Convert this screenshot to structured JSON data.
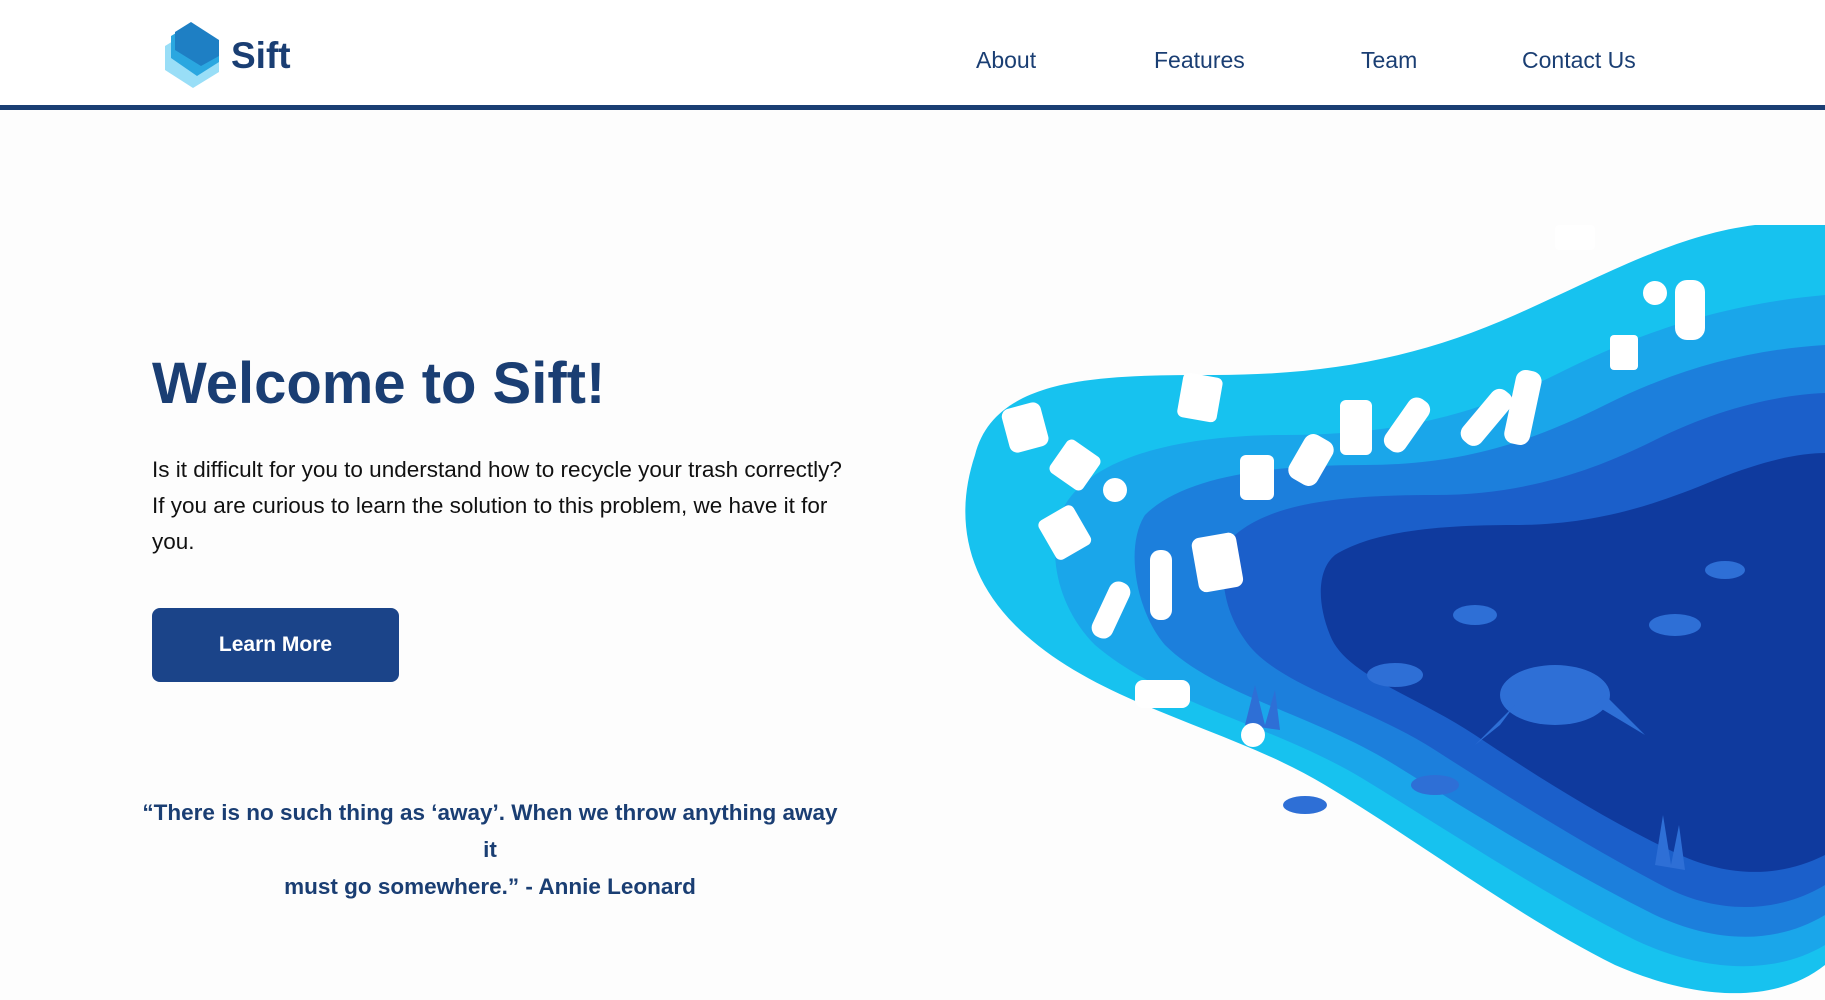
{
  "header": {
    "brand": "Sift",
    "nav": [
      {
        "label": "About"
      },
      {
        "label": "Features"
      },
      {
        "label": "Team"
      },
      {
        "label": "Contact Us"
      }
    ]
  },
  "hero": {
    "title": "Welcome to Sift!",
    "body": "Is it difficult for you to understand how to recycle your trash correctly? If you are curious to learn the solution to this problem, we have it for you.",
    "cta_label": "Learn More"
  },
  "quote": {
    "text_line1": "“There is no such thing as ‘away’.   When we throw anything away it",
    "text_line2": "must go somewhere.”   -   Annie Leonard"
  },
  "colors": {
    "brand_navy": "#1a3e73",
    "button_blue": "#1b4489",
    "ocean_light": "#18c3ee",
    "ocean_mid": "#1e88e5",
    "ocean_deep": "#102f8f"
  },
  "icons": {
    "logo": "sift-stacked-layers-icon",
    "illustration": "ocean-plastic-pollution-illustration"
  }
}
